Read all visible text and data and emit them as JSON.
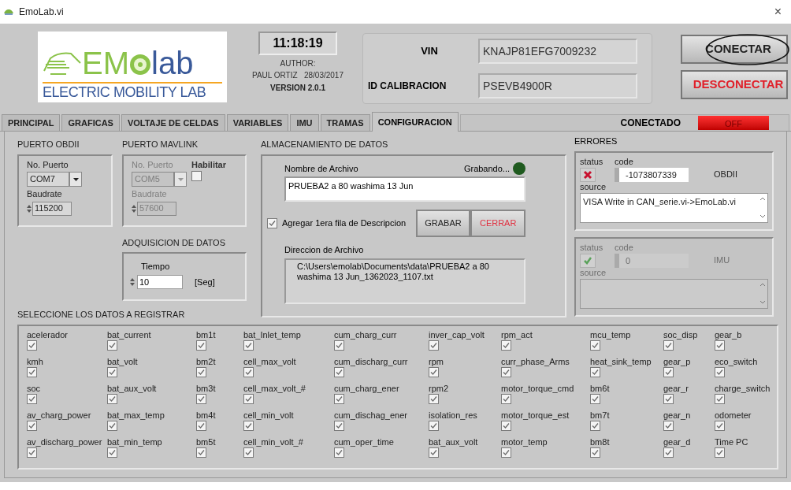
{
  "window": {
    "title": "EmoLab.vi",
    "close": "×"
  },
  "header": {
    "logo": {
      "word_left": "EM",
      "word_right": "lab",
      "tagline": "ELECTRIC MOBILITY LAB"
    },
    "clock": "11:18:19",
    "author_label": "AUTHOR:",
    "author": "PAUL ORTIZ   28/03/2017",
    "version": "VERSION 2.0.1",
    "vin_label": "VIN",
    "vin": "KNAJP81EFG7009232",
    "calib_label": "ID CALIBRACION",
    "calib": "PSEVB4900R",
    "buttons": [
      {
        "label": "CONECTAR",
        "kind": "connect",
        "circled": true
      },
      {
        "label": "DESCONECTAR",
        "kind": "disconnect",
        "circled": false
      }
    ]
  },
  "tabs": [
    {
      "label": "PRINCIPAL",
      "selected": false
    },
    {
      "label": "GRAFICAS",
      "selected": false
    },
    {
      "label": "VOLTAJE DE CELDAS",
      "selected": false
    },
    {
      "label": "VARIABLES",
      "selected": false
    },
    {
      "label": "IMU",
      "selected": false
    },
    {
      "label": "TRAMAS",
      "selected": false
    },
    {
      "label": "CONFIGURACION",
      "selected": true
    }
  ],
  "status": {
    "label": "CONECTADO",
    "led": {
      "label": "OFF",
      "on": false
    }
  },
  "obdii": {
    "title": "PUERTO OBDII",
    "port_label": "No. Puerto",
    "port": "COM7",
    "baud_label": "Baudrate",
    "baud": "115200"
  },
  "mavlink": {
    "title": "PUERTO MAVLINK",
    "disabled": true,
    "port_label": "No. Puerto",
    "port": "COM5",
    "baud_label": "Baudrate",
    "baud": "57600",
    "enable": {
      "label": "Habilitar",
      "checked": false
    }
  },
  "acquisition": {
    "title": "ADQUISICION DE DATOS",
    "label": "Tiempo",
    "value": "10",
    "unit": "[Seg]"
  },
  "storage": {
    "title": "ALMACENAMIENTO DE DATOS",
    "file_label": "Nombre de Archivo",
    "file": "PRUEBA2 a 80 washima 13 Jun",
    "recording": {
      "label": "Grabando...",
      "on": false
    },
    "header_row": {
      "label": "Agregar 1era fila de Descripcion",
      "checked": true
    },
    "buttons": [
      {
        "label": "GRABAR",
        "kind": "normal"
      },
      {
        "label": "CERRAR",
        "kind": "danger"
      }
    ],
    "path_label": "Direccion de Archivo",
    "path": "C:\\Users\\emolab\\Documents\\data\\PRUEBA2 a 80 washima 13 Jun_1362023_1107.txt"
  },
  "errors": {
    "title": "ERRORES",
    "clusters": [
      {
        "status_label": "status",
        "code_label": "code",
        "source_label": "source",
        "failed": true,
        "code": "-1073807339",
        "name": "OBDII",
        "source": "VISA Write in CAN_serie.vi->EmoLab.vi",
        "disabled": false
      },
      {
        "status_label": "status",
        "code_label": "code",
        "source_label": "source",
        "failed": false,
        "code": "0",
        "name": "IMU",
        "disabled": true
      }
    ]
  },
  "selection": {
    "title": "SELECCIONE LOS DATOS A REGISTRAR",
    "items": [
      {
        "label": "acelerador",
        "checked": true
      },
      {
        "label": "bat_current",
        "checked": true
      },
      {
        "label": "bm1t",
        "checked": true
      },
      {
        "label": "bat_Inlet_temp",
        "checked": true
      },
      {
        "label": "cum_charg_curr",
        "checked": true
      },
      {
        "label": "inver_cap_volt",
        "checked": true
      },
      {
        "label": "rpm_act",
        "checked": true
      },
      {
        "label": "mcu_temp",
        "checked": true
      },
      {
        "label": "soc_disp",
        "checked": true
      },
      {
        "label": "gear_b",
        "checked": true
      },
      {
        "label": "kmh",
        "checked": true
      },
      {
        "label": "bat_volt",
        "checked": true
      },
      {
        "label": "bm2t",
        "checked": true
      },
      {
        "label": "cell_max_volt",
        "checked": true
      },
      {
        "label": "cum_discharg_curr",
        "checked": true
      },
      {
        "label": "rpm",
        "checked": true
      },
      {
        "label": "curr_phase_Arms",
        "checked": true
      },
      {
        "label": "heat_sink_temp",
        "checked": true
      },
      {
        "label": "gear_p",
        "checked": true
      },
      {
        "label": "eco_switch",
        "checked": true
      },
      {
        "label": "soc",
        "checked": true
      },
      {
        "label": "bat_aux_volt",
        "checked": true
      },
      {
        "label": "bm3t",
        "checked": true
      },
      {
        "label": "cell_max_volt_#",
        "checked": true
      },
      {
        "label": "cum_charg_ener",
        "checked": true
      },
      {
        "label": "rpm2",
        "checked": true
      },
      {
        "label": "motor_torque_cmd",
        "checked": true
      },
      {
        "label": "bm6t",
        "checked": true
      },
      {
        "label": "gear_r",
        "checked": true
      },
      {
        "label": "charge_switch",
        "checked": true
      },
      {
        "label": "av_charg_power",
        "checked": true
      },
      {
        "label": "bat_max_temp",
        "checked": true
      },
      {
        "label": "bm4t",
        "checked": true
      },
      {
        "label": "cell_min_volt",
        "checked": true
      },
      {
        "label": "cum_dischag_ener",
        "checked": true
      },
      {
        "label": "isolation_res",
        "checked": true
      },
      {
        "label": "motor_torque_est",
        "checked": true
      },
      {
        "label": "bm7t",
        "checked": true
      },
      {
        "label": "gear_n",
        "checked": true
      },
      {
        "label": "odometer",
        "checked": true
      },
      {
        "label": "av_discharg_power",
        "checked": true
      },
      {
        "label": "bat_min_temp",
        "checked": true
      },
      {
        "label": "bm5t",
        "checked": true
      },
      {
        "label": "cell_min_volt_#",
        "checked": true
      },
      {
        "label": "cum_oper_time",
        "checked": true
      },
      {
        "label": "bat_aux_volt",
        "checked": true
      },
      {
        "label": "motor_temp",
        "checked": true
      },
      {
        "label": "bm8t",
        "checked": true
      },
      {
        "label": "gear_d",
        "checked": true
      },
      {
        "label": "Time PC",
        "checked": true
      }
    ]
  }
}
